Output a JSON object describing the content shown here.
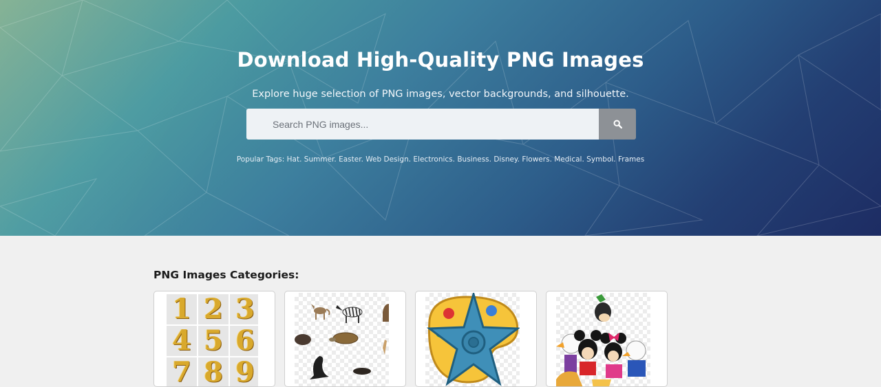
{
  "hero": {
    "title": "Download High-Quality PNG Images",
    "subtitle": "Explore huge selection of PNG images, vector backgrounds, and silhouette.",
    "search": {
      "placeholder": "Search PNG images...",
      "button_icon": "search-icon"
    },
    "tags_label": "Popular Tags:",
    "tags": [
      "Hat",
      "Summer",
      "Easter",
      "Web Design",
      "Electronics",
      "Business",
      "Disney",
      "Flowers",
      "Medical",
      "Symbol",
      "Frames"
    ]
  },
  "categories": {
    "heading": "PNG Images Categories:",
    "cards": [
      {
        "name": "numbers",
        "digits": [
          "1",
          "2",
          "3",
          "4",
          "5",
          "6",
          "7",
          "8",
          "9"
        ]
      },
      {
        "name": "animals"
      },
      {
        "name": "symbols"
      },
      {
        "name": "cartoons"
      }
    ]
  },
  "colors": {
    "hero_gradient_start": "#7fae8f",
    "hero_gradient_end": "#1d2c63",
    "search_button": "#8d9196",
    "page_background": "#f0f0f0"
  }
}
